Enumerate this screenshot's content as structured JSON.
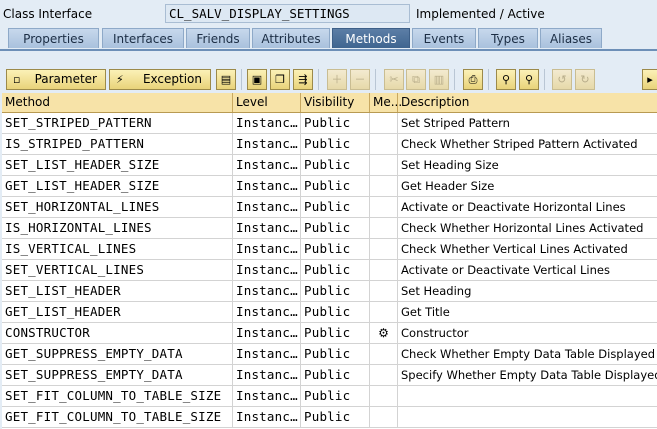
{
  "header": {
    "label": "Class Interface",
    "class_name": "CL_SALV_DISPLAY_SETTINGS",
    "status": "Implemented / Active"
  },
  "tabs": [
    {
      "label": "Properties",
      "active": false
    },
    {
      "label": "Interfaces",
      "active": false
    },
    {
      "label": "Friends",
      "active": false
    },
    {
      "label": "Attributes",
      "active": false
    },
    {
      "label": "Methods",
      "active": true
    },
    {
      "label": "Events",
      "active": false
    },
    {
      "label": "Types",
      "active": false
    },
    {
      "label": "Aliases",
      "active": false
    }
  ],
  "toolbar": {
    "parameter_label": "Parameter",
    "exception_label": "Exception",
    "icons": [
      "source-code-icon",
      "display-icon",
      "copy-icon",
      "navigate-icon",
      "insert-row-icon",
      "delete-row-icon",
      "cut-icon",
      "copy-row-icon",
      "paste-icon",
      "undo-icon",
      "print-icon",
      "find-icon",
      "find-next-icon",
      "filter-icon",
      "more-icon"
    ]
  },
  "table": {
    "columns": {
      "method": "Method",
      "level": "Level",
      "visibility": "Visibility",
      "me": "Me...",
      "description": "Description"
    },
    "rows": [
      {
        "method": "SET_STRIPED_PATTERN",
        "level": "Instanc…",
        "visibility": "Public",
        "me": "",
        "description": "Set Striped Pattern"
      },
      {
        "method": "IS_STRIPED_PATTERN",
        "level": "Instanc…",
        "visibility": "Public",
        "me": "",
        "description": "Check Whether Striped Pattern Activated"
      },
      {
        "method": "SET_LIST_HEADER_SIZE",
        "level": "Instanc…",
        "visibility": "Public",
        "me": "",
        "description": "Set Heading Size"
      },
      {
        "method": "GET_LIST_HEADER_SIZE",
        "level": "Instanc…",
        "visibility": "Public",
        "me": "",
        "description": "Get Header Size"
      },
      {
        "method": "SET_HORIZONTAL_LINES",
        "level": "Instanc…",
        "visibility": "Public",
        "me": "",
        "description": "Activate or Deactivate Horizontal Lines"
      },
      {
        "method": "IS_HORIZONTAL_LINES",
        "level": "Instanc…",
        "visibility": "Public",
        "me": "",
        "description": "Check Whether Horizontal Lines Activated"
      },
      {
        "method": "IS_VERTICAL_LINES",
        "level": "Instanc…",
        "visibility": "Public",
        "me": "",
        "description": "Check Whether Vertical Lines Activated"
      },
      {
        "method": "SET_VERTICAL_LINES",
        "level": "Instanc…",
        "visibility": "Public",
        "me": "",
        "description": "Activate or Deactivate Vertical Lines"
      },
      {
        "method": "SET_LIST_HEADER",
        "level": "Instanc…",
        "visibility": "Public",
        "me": "",
        "description": "Set Heading"
      },
      {
        "method": "GET_LIST_HEADER",
        "level": "Instanc…",
        "visibility": "Public",
        "me": "",
        "description": "Get Title"
      },
      {
        "method": "CONSTRUCTOR",
        "level": "Instanc…",
        "visibility": "Public",
        "me": "constructor-icon",
        "description": "Constructor"
      },
      {
        "method": "GET_SUPPRESS_EMPTY_DATA",
        "level": "Instanc…",
        "visibility": "Public",
        "me": "",
        "description": "Check Whether Empty Data Table Displayed"
      },
      {
        "method": "SET_SUPPRESS_EMPTY_DATA",
        "level": "Instanc…",
        "visibility": "Public",
        "me": "",
        "description": "Specify Whether Empty Data Table Displayed"
      },
      {
        "method": "SET_FIT_COLUMN_TO_TABLE_SIZE",
        "level": "Instanc…",
        "visibility": "Public",
        "me": "",
        "description": ""
      },
      {
        "method": "GET_FIT_COLUMN_TO_TABLE_SIZE",
        "level": "Instanc…",
        "visibility": "Public",
        "me": "",
        "description": ""
      }
    ]
  },
  "colors": {
    "background": "#e3ecf5",
    "active_tab": "#4a6f9a",
    "grid_header": "#f7e3a8",
    "toolbar_button": "#f2e29a"
  }
}
